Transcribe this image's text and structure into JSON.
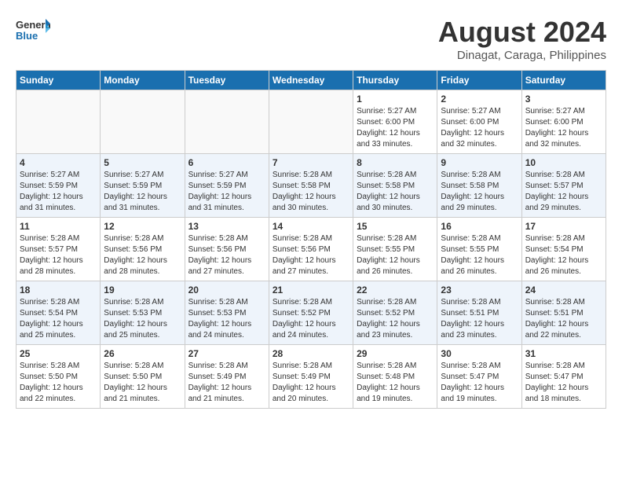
{
  "header": {
    "logo_general": "General",
    "logo_blue": "Blue",
    "title": "August 2024",
    "subtitle": "Dinagat, Caraga, Philippines"
  },
  "columns": [
    "Sunday",
    "Monday",
    "Tuesday",
    "Wednesday",
    "Thursday",
    "Friday",
    "Saturday"
  ],
  "weeks": [
    [
      {
        "day": "",
        "sunrise": "",
        "sunset": "",
        "daylight": "",
        "empty": true
      },
      {
        "day": "",
        "sunrise": "",
        "sunset": "",
        "daylight": "",
        "empty": true
      },
      {
        "day": "",
        "sunrise": "",
        "sunset": "",
        "daylight": "",
        "empty": true
      },
      {
        "day": "",
        "sunrise": "",
        "sunset": "",
        "daylight": "",
        "empty": true
      },
      {
        "day": "1",
        "sunrise": "Sunrise: 5:27 AM",
        "sunset": "Sunset: 6:00 PM",
        "daylight": "Daylight: 12 hours and 33 minutes."
      },
      {
        "day": "2",
        "sunrise": "Sunrise: 5:27 AM",
        "sunset": "Sunset: 6:00 PM",
        "daylight": "Daylight: 12 hours and 32 minutes."
      },
      {
        "day": "3",
        "sunrise": "Sunrise: 5:27 AM",
        "sunset": "Sunset: 6:00 PM",
        "daylight": "Daylight: 12 hours and 32 minutes."
      }
    ],
    [
      {
        "day": "4",
        "sunrise": "Sunrise: 5:27 AM",
        "sunset": "Sunset: 5:59 PM",
        "daylight": "Daylight: 12 hours and 31 minutes."
      },
      {
        "day": "5",
        "sunrise": "Sunrise: 5:27 AM",
        "sunset": "Sunset: 5:59 PM",
        "daylight": "Daylight: 12 hours and 31 minutes."
      },
      {
        "day": "6",
        "sunrise": "Sunrise: 5:27 AM",
        "sunset": "Sunset: 5:59 PM",
        "daylight": "Daylight: 12 hours and 31 minutes."
      },
      {
        "day": "7",
        "sunrise": "Sunrise: 5:28 AM",
        "sunset": "Sunset: 5:58 PM",
        "daylight": "Daylight: 12 hours and 30 minutes."
      },
      {
        "day": "8",
        "sunrise": "Sunrise: 5:28 AM",
        "sunset": "Sunset: 5:58 PM",
        "daylight": "Daylight: 12 hours and 30 minutes."
      },
      {
        "day": "9",
        "sunrise": "Sunrise: 5:28 AM",
        "sunset": "Sunset: 5:58 PM",
        "daylight": "Daylight: 12 hours and 29 minutes."
      },
      {
        "day": "10",
        "sunrise": "Sunrise: 5:28 AM",
        "sunset": "Sunset: 5:57 PM",
        "daylight": "Daylight: 12 hours and 29 minutes."
      }
    ],
    [
      {
        "day": "11",
        "sunrise": "Sunrise: 5:28 AM",
        "sunset": "Sunset: 5:57 PM",
        "daylight": "Daylight: 12 hours and 28 minutes."
      },
      {
        "day": "12",
        "sunrise": "Sunrise: 5:28 AM",
        "sunset": "Sunset: 5:56 PM",
        "daylight": "Daylight: 12 hours and 28 minutes."
      },
      {
        "day": "13",
        "sunrise": "Sunrise: 5:28 AM",
        "sunset": "Sunset: 5:56 PM",
        "daylight": "Daylight: 12 hours and 27 minutes."
      },
      {
        "day": "14",
        "sunrise": "Sunrise: 5:28 AM",
        "sunset": "Sunset: 5:56 PM",
        "daylight": "Daylight: 12 hours and 27 minutes."
      },
      {
        "day": "15",
        "sunrise": "Sunrise: 5:28 AM",
        "sunset": "Sunset: 5:55 PM",
        "daylight": "Daylight: 12 hours and 26 minutes."
      },
      {
        "day": "16",
        "sunrise": "Sunrise: 5:28 AM",
        "sunset": "Sunset: 5:55 PM",
        "daylight": "Daylight: 12 hours and 26 minutes."
      },
      {
        "day": "17",
        "sunrise": "Sunrise: 5:28 AM",
        "sunset": "Sunset: 5:54 PM",
        "daylight": "Daylight: 12 hours and 26 minutes."
      }
    ],
    [
      {
        "day": "18",
        "sunrise": "Sunrise: 5:28 AM",
        "sunset": "Sunset: 5:54 PM",
        "daylight": "Daylight: 12 hours and 25 minutes."
      },
      {
        "day": "19",
        "sunrise": "Sunrise: 5:28 AM",
        "sunset": "Sunset: 5:53 PM",
        "daylight": "Daylight: 12 hours and 25 minutes."
      },
      {
        "day": "20",
        "sunrise": "Sunrise: 5:28 AM",
        "sunset": "Sunset: 5:53 PM",
        "daylight": "Daylight: 12 hours and 24 minutes."
      },
      {
        "day": "21",
        "sunrise": "Sunrise: 5:28 AM",
        "sunset": "Sunset: 5:52 PM",
        "daylight": "Daylight: 12 hours and 24 minutes."
      },
      {
        "day": "22",
        "sunrise": "Sunrise: 5:28 AM",
        "sunset": "Sunset: 5:52 PM",
        "daylight": "Daylight: 12 hours and 23 minutes."
      },
      {
        "day": "23",
        "sunrise": "Sunrise: 5:28 AM",
        "sunset": "Sunset: 5:51 PM",
        "daylight": "Daylight: 12 hours and 23 minutes."
      },
      {
        "day": "24",
        "sunrise": "Sunrise: 5:28 AM",
        "sunset": "Sunset: 5:51 PM",
        "daylight": "Daylight: 12 hours and 22 minutes."
      }
    ],
    [
      {
        "day": "25",
        "sunrise": "Sunrise: 5:28 AM",
        "sunset": "Sunset: 5:50 PM",
        "daylight": "Daylight: 12 hours and 22 minutes."
      },
      {
        "day": "26",
        "sunrise": "Sunrise: 5:28 AM",
        "sunset": "Sunset: 5:50 PM",
        "daylight": "Daylight: 12 hours and 21 minutes."
      },
      {
        "day": "27",
        "sunrise": "Sunrise: 5:28 AM",
        "sunset": "Sunset: 5:49 PM",
        "daylight": "Daylight: 12 hours and 21 minutes."
      },
      {
        "day": "28",
        "sunrise": "Sunrise: 5:28 AM",
        "sunset": "Sunset: 5:49 PM",
        "daylight": "Daylight: 12 hours and 20 minutes."
      },
      {
        "day": "29",
        "sunrise": "Sunrise: 5:28 AM",
        "sunset": "Sunset: 5:48 PM",
        "daylight": "Daylight: 12 hours and 19 minutes."
      },
      {
        "day": "30",
        "sunrise": "Sunrise: 5:28 AM",
        "sunset": "Sunset: 5:47 PM",
        "daylight": "Daylight: 12 hours and 19 minutes."
      },
      {
        "day": "31",
        "sunrise": "Sunrise: 5:28 AM",
        "sunset": "Sunset: 5:47 PM",
        "daylight": "Daylight: 12 hours and 18 minutes."
      }
    ]
  ],
  "row_shades": [
    "white",
    "shade",
    "white",
    "shade",
    "white"
  ]
}
